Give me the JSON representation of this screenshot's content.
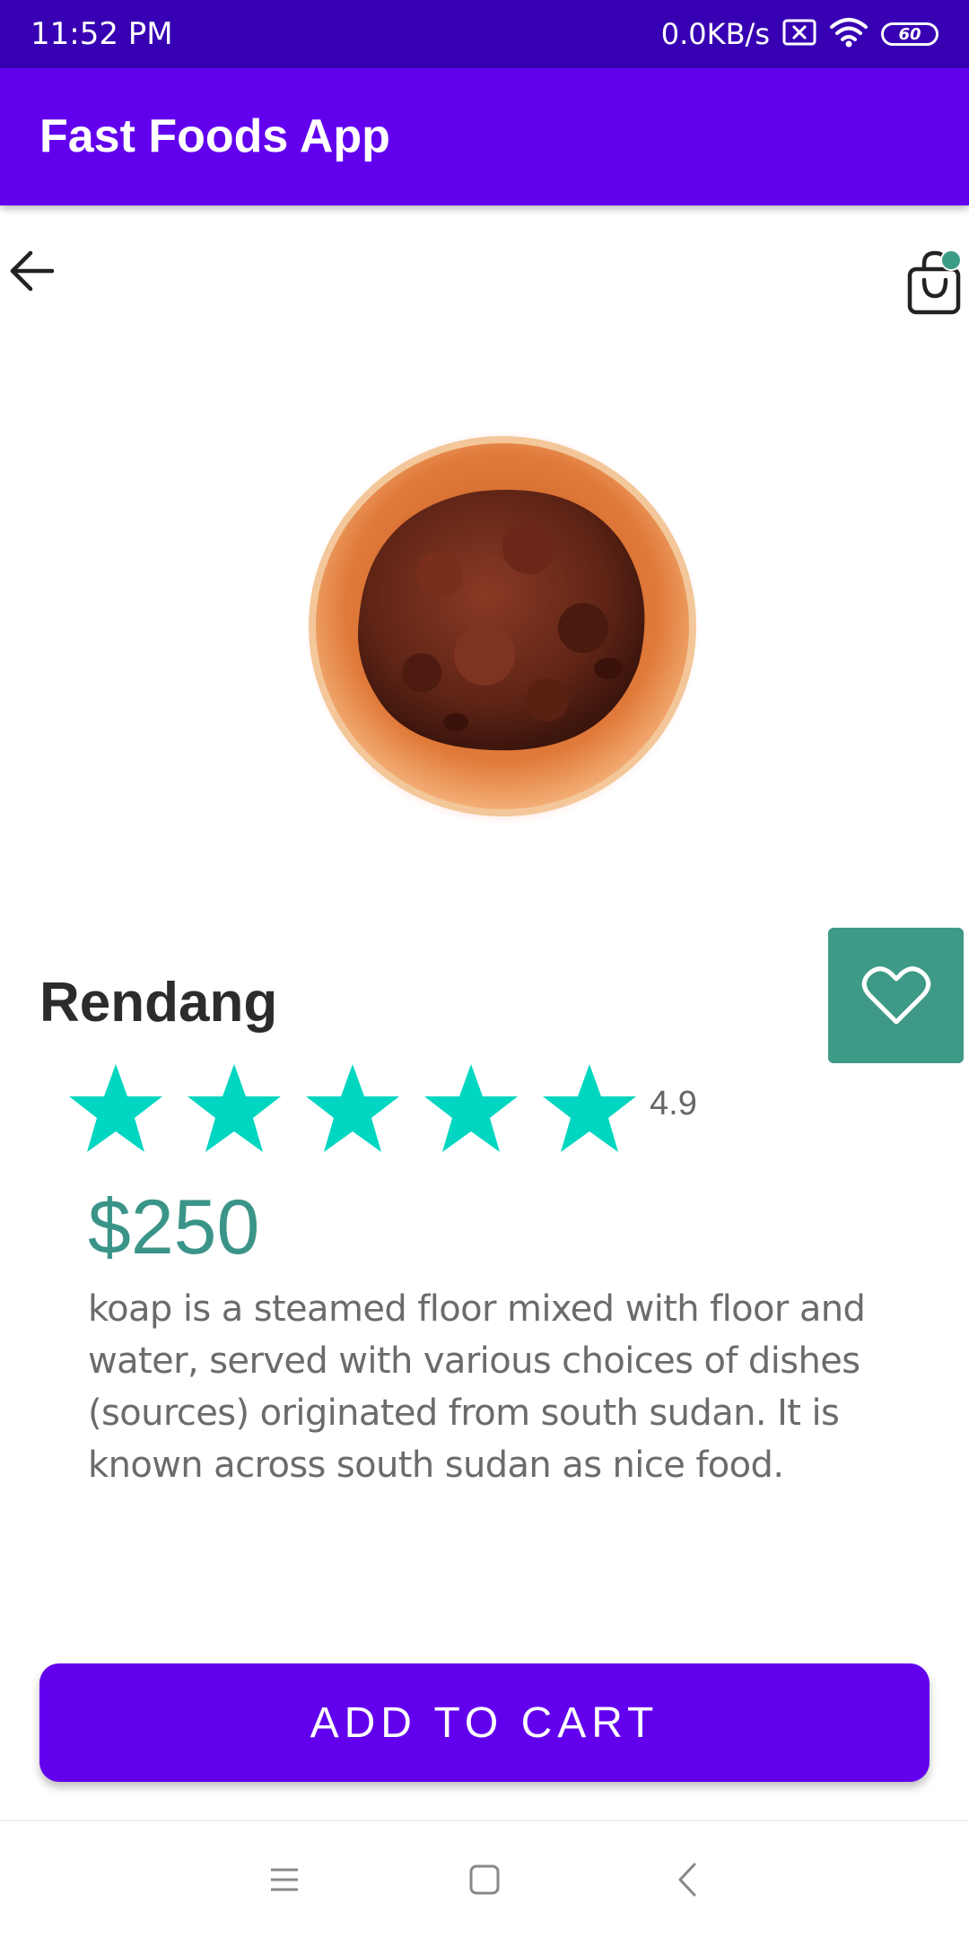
{
  "status_bar": {
    "time": "11:52 PM",
    "network_speed": "0.0KB/s",
    "battery_level": "60",
    "icons": [
      "sim-x-icon",
      "wifi-icon",
      "battery-icon"
    ]
  },
  "app_bar": {
    "title": "Fast Foods App"
  },
  "toolbar": {
    "back_icon": "back-arrow-icon",
    "cart_icon": "shopping-bag-icon",
    "cart_badge_color": "#3b9c86"
  },
  "product": {
    "name": "Rendang",
    "rating": "4.9",
    "stars_filled": 5,
    "stars_total": 5,
    "price": "$250",
    "description": "koap is a steamed floor mixed with floor and water, served with various choices of dishes (sources) originated from south sudan. It is known across south sudan as nice food.",
    "favorite_icon": "heart-outline-icon"
  },
  "actions": {
    "add_to_cart_label": "ADD TO CART"
  },
  "nav_bar": {
    "icons": [
      "menu-icon",
      "home-square-icon",
      "back-chevron-icon"
    ]
  },
  "colors": {
    "status_bar": "#3700b3",
    "primary": "#6200ee",
    "accent_green": "#3f9987",
    "star": "#00d6c0",
    "price": "#3b9488"
  }
}
